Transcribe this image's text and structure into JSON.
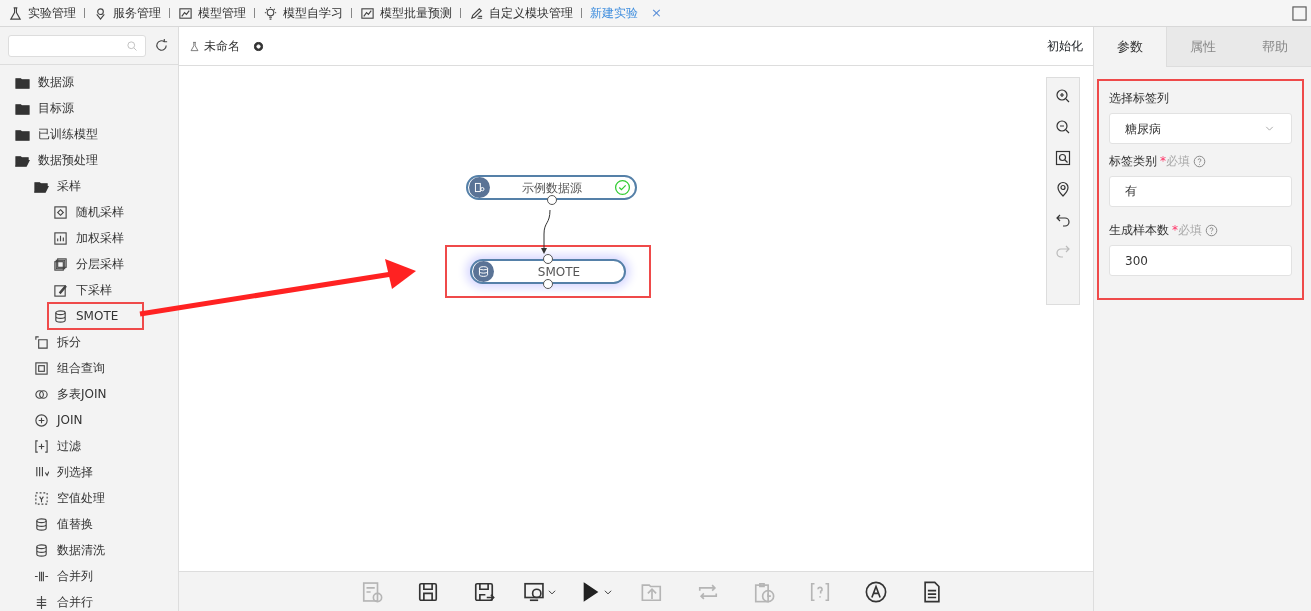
{
  "top_tabs": [
    {
      "label": "实验管理",
      "selected": false
    },
    {
      "label": "服务管理",
      "selected": false
    },
    {
      "label": "模型管理",
      "selected": false
    },
    {
      "label": "模型自学习",
      "selected": false
    },
    {
      "label": "模型批量预测",
      "selected": false
    },
    {
      "label": "自定义模块管理",
      "selected": false
    },
    {
      "label": "新建实验",
      "selected": true,
      "close": "×"
    }
  ],
  "sidebar": {
    "tree": [
      {
        "label": "数据源",
        "kind": "folder",
        "expanded": false
      },
      {
        "label": "目标源",
        "kind": "folder",
        "expanded": false
      },
      {
        "label": "已训练模型",
        "kind": "folder",
        "expanded": false
      },
      {
        "label": "数据预处理",
        "kind": "folder",
        "expanded": true,
        "children": [
          {
            "label": "采样",
            "kind": "folder",
            "expanded": true,
            "children": [
              {
                "label": "随机采样",
                "kind": "module"
              },
              {
                "label": "加权采样",
                "kind": "module"
              },
              {
                "label": "分层采样",
                "kind": "module"
              },
              {
                "label": "下采样",
                "kind": "module"
              },
              {
                "label": "SMOTE",
                "kind": "module",
                "highlighted": true
              }
            ]
          },
          {
            "label": "拆分",
            "kind": "module"
          },
          {
            "label": "组合查询",
            "kind": "module"
          },
          {
            "label": "多表JOIN",
            "kind": "module"
          },
          {
            "label": "JOIN",
            "kind": "module"
          },
          {
            "label": "过滤",
            "kind": "module"
          },
          {
            "label": "列选择",
            "kind": "module"
          },
          {
            "label": "空值处理",
            "kind": "module"
          },
          {
            "label": "值替换",
            "kind": "module"
          },
          {
            "label": "数据清洗",
            "kind": "module"
          },
          {
            "label": "合并列",
            "kind": "module"
          },
          {
            "label": "合并行",
            "kind": "module"
          }
        ]
      }
    ]
  },
  "canvas": {
    "title": "未命名",
    "init_button": "初始化",
    "nodes": [
      {
        "label": "示例数据源",
        "kind": "source",
        "done": true,
        "highlighted": false
      },
      {
        "label": "SMOTE",
        "kind": "database",
        "done": false,
        "highlighted": true
      }
    ],
    "side_tools": [
      {
        "disabled": false
      },
      {
        "disabled": false
      },
      {
        "disabled": false
      },
      {
        "disabled": false
      },
      {
        "disabled": false
      },
      {
        "disabled": true
      }
    ],
    "toolbar": [
      {
        "disabled": true,
        "dropdown": false
      },
      {
        "disabled": false,
        "dropdown": false
      },
      {
        "disabled": false,
        "dropdown": false
      },
      {
        "disabled": false,
        "dropdown": true
      },
      {
        "disabled": false,
        "dropdown": true
      },
      {
        "disabled": true,
        "dropdown": false
      },
      {
        "disabled": true,
        "dropdown": false
      },
      {
        "disabled": true,
        "dropdown": false
      },
      {
        "disabled": true,
        "dropdown": false
      },
      {
        "disabled": false,
        "dropdown": false
      },
      {
        "disabled": false,
        "dropdown": false
      }
    ]
  },
  "annotation_arrow": true,
  "panel": {
    "tabs": [
      {
        "label": "参数",
        "selected": true
      },
      {
        "label": "属性",
        "selected": false
      },
      {
        "label": "帮助",
        "selected": false
      }
    ],
    "highlighted": true,
    "fields": [
      {
        "label": "选择标签列",
        "kind": "select",
        "value": "糖尿病"
      },
      {
        "label": "标签类别",
        "required_mark": "*",
        "required": "必填",
        "help": true,
        "kind": "input",
        "value": "有"
      },
      {
        "label": "生成样本数",
        "required_mark": "*",
        "required": "必填",
        "help": true,
        "kind": "input",
        "value": "300"
      }
    ]
  }
}
